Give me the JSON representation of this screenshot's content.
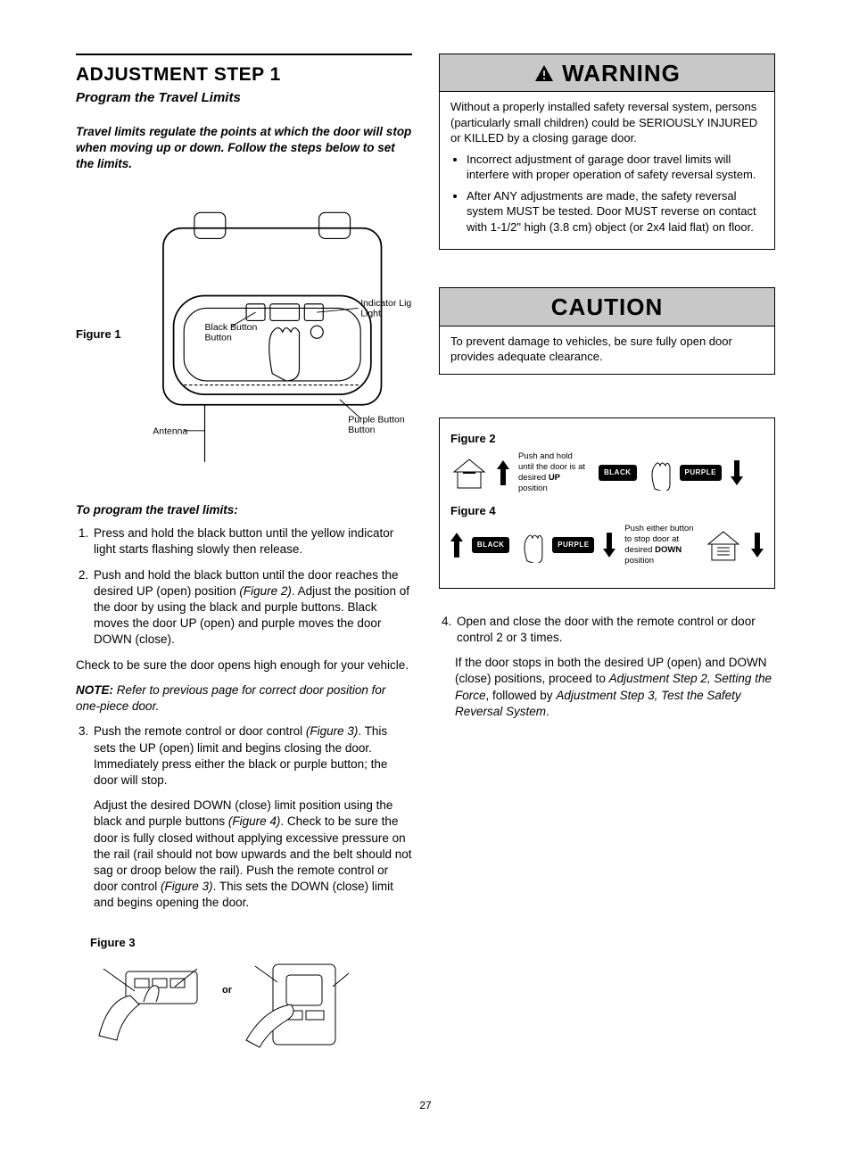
{
  "left": {
    "heading": "ADJUSTMENT STEP 1",
    "subtitle": "Program the Travel Limits",
    "intro": "Travel limits regulate the points at which the door will stop when moving up or down. Follow the steps below to set the limits.",
    "figure1_label": "Figure 1",
    "fig1": {
      "black_button": "Black Button",
      "indicator": "Indicator Light",
      "antenna": "Antenna",
      "purple_button": "Purple Button"
    },
    "program_header": "To program the travel limits:",
    "step1": "Press and hold the black button until the yellow indicator light starts flashing slowly then release.",
    "step2a": "Push and hold the black button until the door reaches the desired UP (open) position ",
    "step2_fig": "(Figure 2)",
    "step2b": ". Adjust the position of the door by using the black and purple buttons. Black moves the door UP (open) and purple moves the door DOWN (close).",
    "check_line": "Check to be sure the door opens high enough for your vehicle.",
    "note_label": "NOTE:",
    "note_text": " Refer to previous page for correct door position for one-piece door.",
    "step3a": "Push the remote control or door control ",
    "step3_fig": "(Figure 3)",
    "step3b": ". This sets the UP (open) limit and begins closing the door. Immediately press either the black or purple button; the door will stop.",
    "step3c1": "Adjust the desired DOWN (close) limit position using the black and purple buttons ",
    "step3c_fig4": "(Figure 4)",
    "step3c2": ". Check to be sure the door is fully closed without applying excessive pressure on the rail (rail should not bow upwards and the belt should not sag or droop below the rail). Push the remote control or door control ",
    "step3c_fig3": "(Figure 3)",
    "step3c3": ". This sets the DOWN (close) limit and begins opening the door.",
    "figure3_label": "Figure 3",
    "fig3_or": "or"
  },
  "right": {
    "warning_title": "WARNING",
    "warning_body": "Without a properly installed safety reversal system, persons (particularly small children) could be SERIOUSLY INJURED or KILLED by a closing garage door.",
    "warning_b1": "Incorrect adjustment of garage door travel limits will interfere with proper operation of safety reversal system.",
    "warning_b2": "After ANY adjustments are made, the safety reversal system MUST be tested. Door MUST reverse on contact with 1-1/2\" high (3.8 cm) object (or 2x4 laid flat) on floor.",
    "caution_title": "CAUTION",
    "caution_body": "To prevent damage to vehicles, be sure fully open door provides adequate clearance.",
    "figure2_label": "Figure 2",
    "figure4_label": "Figure 4",
    "fig2_text_a": "Push and hold until the door is at desired ",
    "fig2_up": "UP",
    "fig2_text_b": " position",
    "fig4_text_a": "Push either button to stop door at desired ",
    "fig4_down": "DOWN",
    "fig4_text_b": " position",
    "black_btn": "BLACK",
    "purple_btn": "PURPLE",
    "step4": "Open and close the door with the remote control or door control 2 or 3 times.",
    "after4a": "If the door stops in both the desired UP (open) and DOWN (close) positions, proceed to ",
    "after4_i1": "Adjustment Step 2, Setting the Force",
    "after4b": ", followed by ",
    "after4_i2": "Adjustment Step 3, Test the Safety Reversal System",
    "after4c": "."
  },
  "page_number": "27"
}
